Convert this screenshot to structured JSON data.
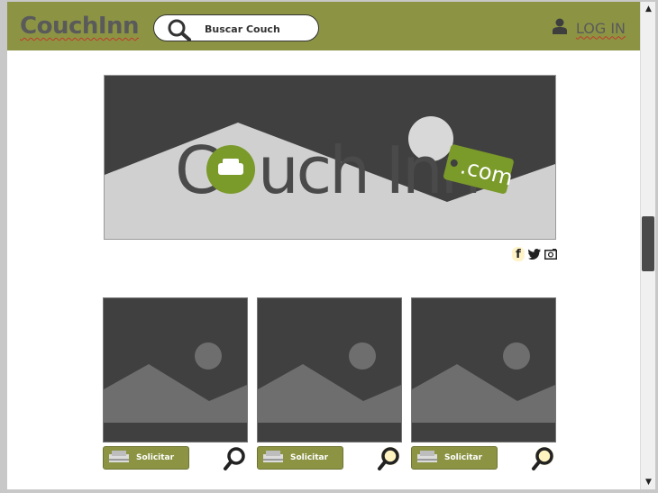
{
  "header": {
    "logo": "CouchInn",
    "search": {
      "value": "Buscar Couch",
      "icon": "search-icon"
    },
    "login": {
      "label": "LOG IN",
      "icon": "user-icon"
    }
  },
  "banner": {
    "logo_text": "Couch Inn",
    "tag_text": ".com",
    "colors": {
      "brand_green": "#8c9444",
      "logo_green": "#7a9a2a",
      "dark": "#404040",
      "light": "#d0d0d0"
    }
  },
  "social": [
    {
      "name": "facebook-icon",
      "glyph": "f"
    },
    {
      "name": "twitter-icon",
      "glyph": "twitter"
    },
    {
      "name": "instagram-icon",
      "glyph": "camera"
    }
  ],
  "cards": [
    {
      "button_label": "Solicitar",
      "zoom_highlight": false
    },
    {
      "button_label": "Solicitar",
      "zoom_highlight": true
    },
    {
      "button_label": "Solicitar",
      "zoom_highlight": true
    }
  ],
  "scrollbar": {
    "up_glyph": "▲",
    "down_glyph": "▼"
  }
}
